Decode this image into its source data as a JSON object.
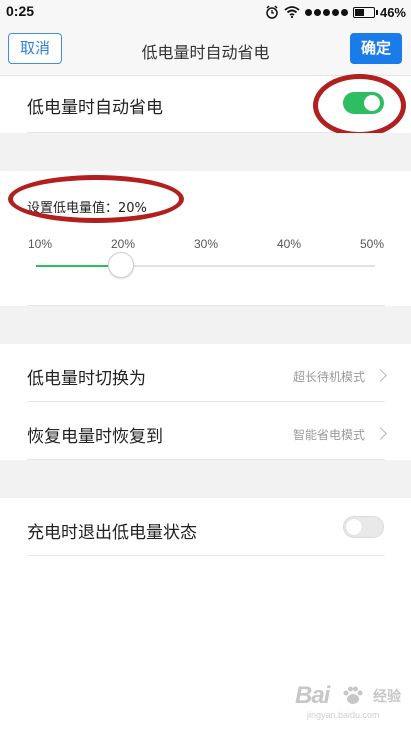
{
  "status_bar": {
    "time": "0:25",
    "battery_percent": "46%",
    "icons": [
      "alarm-icon",
      "wifi-icon",
      "signal-dots-icon",
      "battery-icon"
    ]
  },
  "nav": {
    "cancel_label": "取消",
    "title": "低电量时自动省电",
    "confirm_label": "确定",
    "accent_color": "#1a7ce8"
  },
  "auto_save": {
    "label": "低电量时自动省电",
    "enabled": true,
    "toggle_color": "#2fbd62"
  },
  "threshold": {
    "label": "设置低电量值：20%",
    "value_percent": 20,
    "ticks": [
      "10%",
      "20%",
      "30%",
      "40%",
      "50%"
    ],
    "range": [
      10,
      50
    ]
  },
  "switch_mode": {
    "label": "低电量时切换为",
    "value": "超长待机模式"
  },
  "restore_mode": {
    "label": "恢复电量时恢复到",
    "value": "智能省电模式"
  },
  "exit_on_charge": {
    "label": "充电时退出低电量状态",
    "enabled": false
  },
  "annotation_color": "#b11f1f",
  "watermark": {
    "logo": "Bai",
    "logo_suffix": "经验",
    "url": "jingyan.baidu.com"
  }
}
